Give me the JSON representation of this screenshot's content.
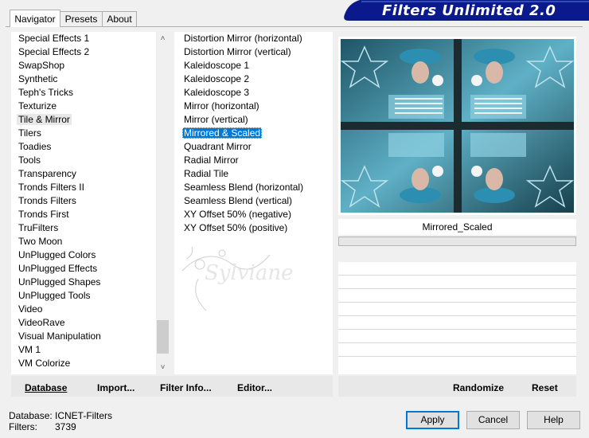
{
  "tabs": [
    "Navigator",
    "Presets",
    "About"
  ],
  "banner_title": "Filters Unlimited 2.0",
  "categories": [
    "Special Effects 1",
    "Special Effects 2",
    "SwapShop",
    "Synthetic",
    "Teph's Tricks",
    "Texturize",
    "Tile & Mirror",
    "Tilers",
    "Toadies",
    "Tools",
    "Transparency",
    "Tronds Filters II",
    "Tronds Filters",
    "Tronds First",
    "TruFilters",
    "Two Moon",
    "UnPlugged Colors",
    "UnPlugged Effects",
    "UnPlugged Shapes",
    "UnPlugged Tools",
    "Video",
    "VideoRave",
    "Visual Manipulation",
    "VM 1",
    "VM Colorize"
  ],
  "selected_category": "Tile & Mirror",
  "filters": [
    "Distortion Mirror (horizontal)",
    "Distortion Mirror (vertical)",
    "Kaleidoscope 1",
    "Kaleidoscope 2",
    "Kaleidoscope 3",
    "Mirror (horizontal)",
    "Mirror (vertical)",
    "Mirrored & Scaled",
    "Quadrant Mirror",
    "Radial Mirror",
    "Radial Tile",
    "Seamless Blend (horizontal)",
    "Seamless Blend (vertical)",
    "XY Offset 50% (negative)",
    "XY Offset 50% (positive)"
  ],
  "selected_filter": "Mirrored & Scaled",
  "watermark": "Sylviane",
  "preview_filter_name": "Mirrored_Scaled",
  "bottom_buttons": {
    "database": "Database",
    "import": "Import...",
    "filter_info": "Filter Info...",
    "editor": "Editor...",
    "randomize": "Randomize",
    "reset": "Reset"
  },
  "status": {
    "database_label": "Database:",
    "database_value": "ICNET-Filters",
    "filters_label": "Filters:",
    "filters_value": "3739"
  },
  "dialog_buttons": {
    "apply": "Apply",
    "cancel": "Cancel",
    "help": "Help"
  },
  "colors": {
    "banner": "#0a1a8c",
    "selection": "#0078d7",
    "preview_teal": "#3f8fa6"
  }
}
